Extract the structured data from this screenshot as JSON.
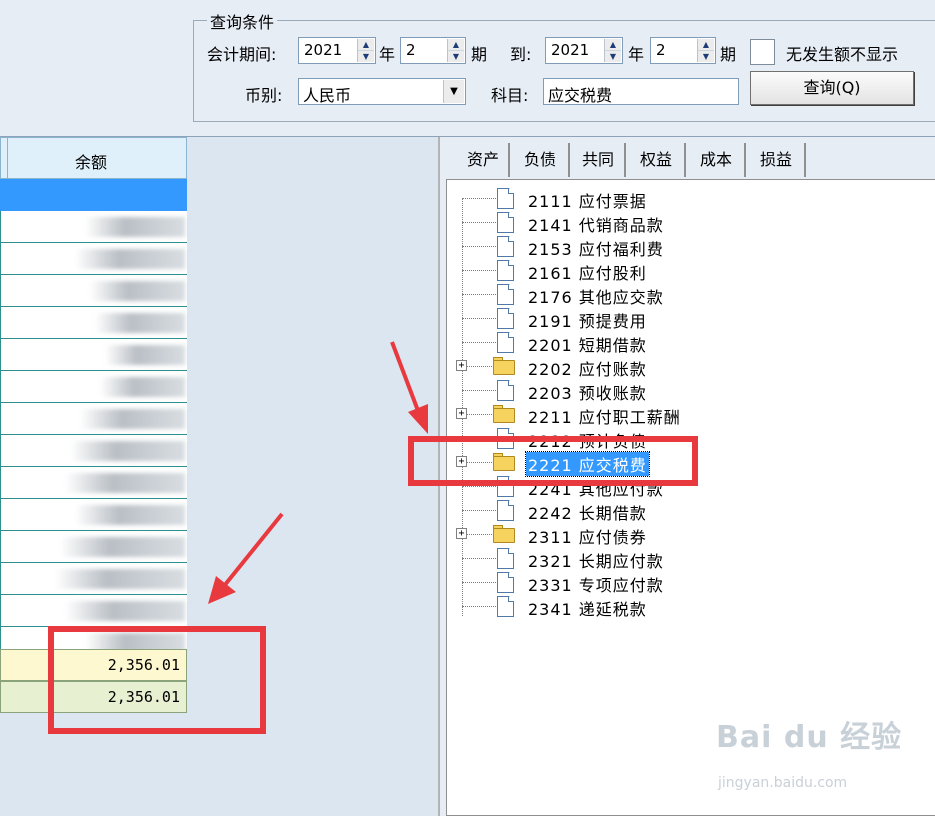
{
  "query": {
    "legend": "查询条件",
    "period_label": "会计期间:",
    "from_year": "2021",
    "year_label": "年",
    "from_month": "2",
    "period_suffix": "期",
    "to_label": "到:",
    "to_year": "2021",
    "to_year_label": "年",
    "to_month": "2",
    "to_period_suffix": "期",
    "hide_zero_label": "无发生额不显示",
    "currency_label": "币别:",
    "currency_value": "人民币",
    "subject_label": "科目:",
    "subject_value": "应交税费",
    "query_button": "查询(Q)"
  },
  "grid": {
    "column_header": "余额",
    "total_1": "2,356.01",
    "total_2": "2,356.01"
  },
  "tabs": [
    "资产",
    "负债",
    "共同",
    "权益",
    "成本",
    "损益"
  ],
  "tree": {
    "nodes": [
      "2111  应付票据",
      "2141  代销商品款",
      "2153  应付福利费",
      "2161  应付股利",
      "2176  其他应交款",
      "2191  预提费用",
      "2201  短期借款",
      "2202  应付账款",
      "2203  预收账款",
      "2211  应付职工薪酬",
      "2212  预计负债",
      "2221  应交税费",
      "2241  其他应付款",
      "2242  长期借款",
      "2311  应付债券",
      "2321  长期应付款",
      "2331  专项应付款",
      "2341  递延税款"
    ]
  },
  "colors": {
    "highlight": "#e8393f",
    "selection": "#3399ff",
    "total_row_1": "#fdf8d0",
    "total_row_2": "#e8f0d2"
  },
  "icons": [
    "plus-expander-icon",
    "file-icon",
    "folder-icon",
    "spin-up-icon",
    "spin-down-icon",
    "dropdown-arrow-icon"
  ],
  "watermark": {
    "logo": "Bai du 经验",
    "url": "jingyan.baidu.com"
  }
}
